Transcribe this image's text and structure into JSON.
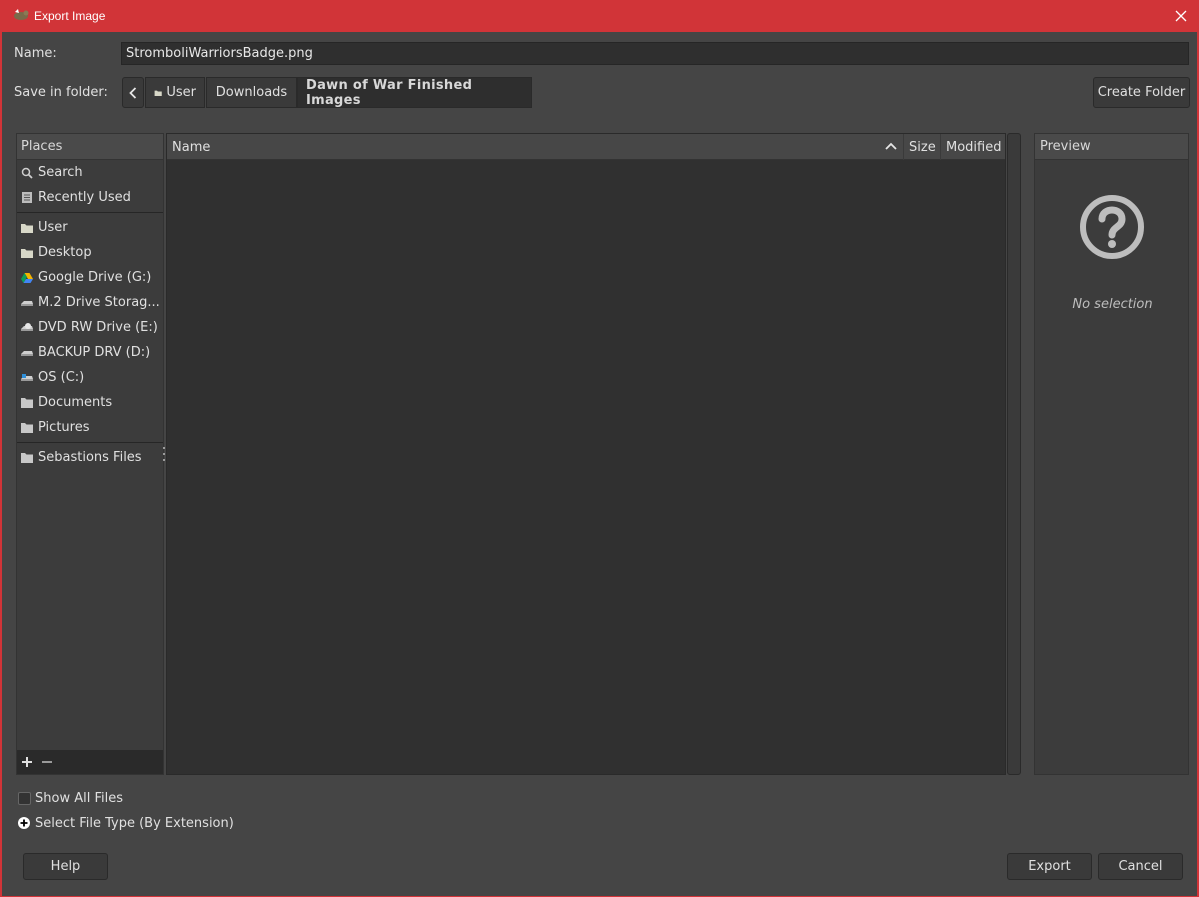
{
  "window": {
    "title": "Export Image",
    "accent_color": "#d13438"
  },
  "form": {
    "name_label": "Name:",
    "name_value": "StromboliWarriorsBadge.png",
    "save_in_label": "Save in folder:"
  },
  "breadcrumbs": {
    "back_icon": "chevron-left-icon",
    "items": [
      {
        "label": "User",
        "icon": "folder-icon"
      },
      {
        "label": "Downloads"
      },
      {
        "label": "Dawn of War Finished Images",
        "active": true
      }
    ]
  },
  "toolbar": {
    "create_folder_label": "Create Folder"
  },
  "places": {
    "header": "Places",
    "items": [
      {
        "label": "Search",
        "icon": "search-icon"
      },
      {
        "label": "Recently Used",
        "icon": "recent-icon"
      },
      {
        "label": "User",
        "icon": "folder-icon"
      },
      {
        "label": "Desktop",
        "icon": "folder-icon"
      },
      {
        "label": "Google Drive (G:)",
        "icon": "google-drive-icon"
      },
      {
        "label": "M.2 Drive Storag...",
        "icon": "drive-icon"
      },
      {
        "label": "DVD RW Drive (E:)",
        "icon": "dvd-icon"
      },
      {
        "label": "BACKUP DRV (D:)",
        "icon": "drive-icon"
      },
      {
        "label": "OS (C:)",
        "icon": "os-drive-icon"
      },
      {
        "label": "Documents",
        "icon": "folder-icon"
      },
      {
        "label": "Pictures",
        "icon": "folder-icon"
      },
      {
        "label": "Sebastions Files",
        "icon": "folder-icon"
      }
    ],
    "add_icon": "plus-icon",
    "remove_icon": "minus-icon"
  },
  "filelist": {
    "columns": [
      "Name",
      "Size",
      "Modified"
    ],
    "sort_icon": "sort-ascending-icon"
  },
  "preview": {
    "header": "Preview",
    "empty_text": "No selection"
  },
  "options": {
    "show_all_files_label": "Show All Files",
    "show_all_files_checked": false,
    "file_type_label": "Select File Type (By Extension)"
  },
  "actions": {
    "help_label": "Help",
    "export_label": "Export",
    "cancel_label": "Cancel"
  }
}
